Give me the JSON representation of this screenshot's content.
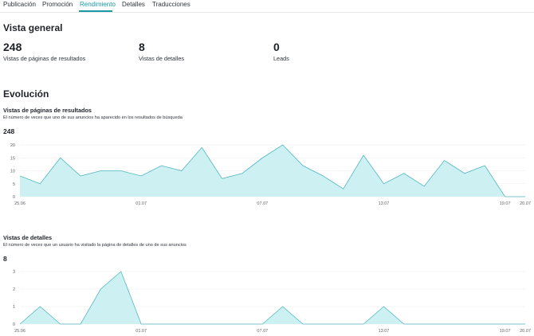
{
  "tabs": [
    {
      "label": "Publicación",
      "active": false
    },
    {
      "label": "Promoción",
      "active": false
    },
    {
      "label": "Rendimiento",
      "active": true
    },
    {
      "label": "Detalles",
      "active": false
    },
    {
      "label": "Traducciones",
      "active": false
    }
  ],
  "overview": {
    "title": "Vista general",
    "stats": [
      {
        "value": "248",
        "label": "Vistas de páginas de resultados"
      },
      {
        "value": "8",
        "label": "Vistas de detalles"
      },
      {
        "value": "0",
        "label": "Leads"
      }
    ]
  },
  "evolution": {
    "title": "Evolución"
  },
  "colors": {
    "accent": "#1a9aa5",
    "fill": "#cdf0f2",
    "line": "#52b7c1"
  },
  "chart_data": [
    {
      "type": "area",
      "title": "Vistas de páginas de resultados",
      "description": "El número de veces que uno de sus anuncios ha aparecido en los resultados de búsqueda",
      "total": "248",
      "x": [
        "25.06",
        "26.06",
        "27.06",
        "28.06",
        "29.06",
        "30.06",
        "01.07",
        "02.07",
        "03.07",
        "04.07",
        "05.07",
        "06.07",
        "07.07",
        "08.07",
        "09.07",
        "10.07",
        "11.07",
        "12.07",
        "13.07",
        "14.07",
        "15.07",
        "16.07",
        "17.07",
        "18.07",
        "19.07",
        "20.07"
      ],
      "x_tick_labels": [
        "25.06",
        "01.07",
        "07.07",
        "13.07",
        "19.07",
        "20.07"
      ],
      "values": [
        8,
        5,
        15,
        8,
        10,
        10,
        8,
        12,
        10,
        19,
        7,
        9,
        15,
        20,
        12,
        8,
        3,
        16,
        5,
        9,
        4,
        14,
        9,
        12,
        0,
        0
      ],
      "y_ticks": [
        0,
        5,
        10,
        15,
        20
      ],
      "ylim": [
        0,
        20
      ],
      "grid": true
    },
    {
      "type": "area",
      "title": "Vistas de detalles",
      "description": "El número de veces que un usuario ha visitado la página de detalles de uno de sus anuncios",
      "total": "8",
      "x": [
        "25.06",
        "26.06",
        "27.06",
        "28.06",
        "29.06",
        "30.06",
        "01.07",
        "02.07",
        "03.07",
        "04.07",
        "05.07",
        "06.07",
        "07.07",
        "08.07",
        "09.07",
        "10.07",
        "11.07",
        "12.07",
        "13.07",
        "14.07",
        "15.07",
        "16.07",
        "17.07",
        "18.07",
        "19.07",
        "20.07"
      ],
      "x_tick_labels": [
        "25.06",
        "01.07",
        "07.07",
        "13.07",
        "19.07",
        "20.07"
      ],
      "values": [
        0,
        1,
        0,
        0,
        2,
        3,
        0,
        0,
        0,
        0,
        0,
        0,
        0,
        1,
        0,
        0,
        0,
        0,
        1,
        0,
        0,
        0,
        0,
        0,
        0,
        0
      ],
      "y_ticks": [
        0,
        1,
        2,
        3
      ],
      "ylim": [
        0,
        3
      ],
      "grid": true
    }
  ]
}
